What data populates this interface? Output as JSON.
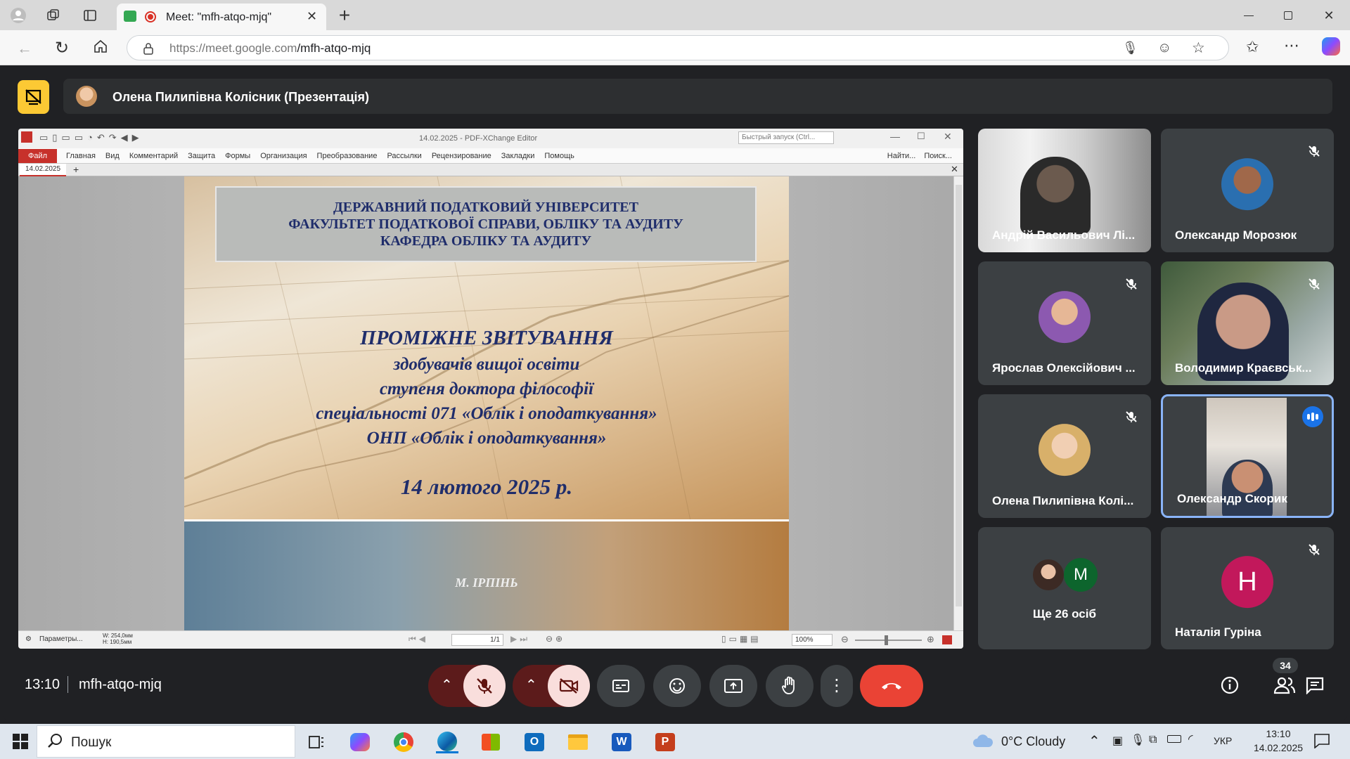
{
  "browser": {
    "tab_title": "Meet: \"mfh-atqo-mjq\"",
    "url_host": "https://meet.google.com",
    "url_path": "/mfh-atqo-mjq"
  },
  "presentation": {
    "presenter": "Олена Пилипівна Колісник (Презентація)"
  },
  "pdf_editor": {
    "window_title": "14.02.2025 - PDF-XChange Editor",
    "quick_launch": "Быстрый запуск (Ctrl...",
    "menu": [
      "Файл",
      "Главная",
      "Вид",
      "Комментарий",
      "Защита",
      "Формы",
      "Организация",
      "Преобразование",
      "Рассылки",
      "Рецензирование",
      "Закладки",
      "Помощь"
    ],
    "find": "Найти...",
    "search": "Поиск...",
    "doc_tab": "14.02.2025",
    "status_params": "Параметры...",
    "status_size_w": "W: 254,0мм",
    "status_size_h": "H: 190,5мм",
    "page_field": "1/1",
    "zoom": "100%"
  },
  "slide": {
    "header_lines": [
      "ДЕРЖАВНИЙ ПОДАТКОВИЙ УНІВЕРСИТЕТ",
      "ФАКУЛЬТЕТ ПОДАТКОВОЇ СПРАВИ, ОБЛІКУ ТА АУДИТУ",
      "КАФЕДРА ОБЛІКУ ТА АУДИТУ"
    ],
    "title": "ПРОМІЖНЕ ЗВІТУВАННЯ",
    "lines": [
      "здобувачів вищої освіти",
      "ступеня доктора філософії",
      "спеціальності 071 «Облік і оподаткування»",
      "ОНП «Облік і оподаткування»"
    ],
    "date": "14 лютого 2025 р.",
    "city": "М. ІРПІНЬ"
  },
  "participants": [
    {
      "name": "Андрій Васильович Лі...",
      "muted": false
    },
    {
      "name": "Олександр Морозюк",
      "muted": true
    },
    {
      "name": "Ярослав Олексійович ...",
      "muted": true
    },
    {
      "name": "Володимир Краєвськ...",
      "muted": true
    },
    {
      "name": "Олена Пилипівна Колі...",
      "muted": true
    },
    {
      "name": "Олександр Скорик",
      "muted": false,
      "speaking": true
    },
    {
      "name": "Ще 26 осіб",
      "avatar_letter": "M"
    },
    {
      "name": "Наталія Гуріна",
      "avatar_letter": "Н",
      "muted": true
    }
  ],
  "meeting": {
    "time": "13:10",
    "code": "mfh-atqo-mjq",
    "people_count": "34"
  },
  "taskbar": {
    "search_placeholder": "Пошук",
    "weather": "0°C  Cloudy",
    "lang": "УКР",
    "clock_time": "13:10",
    "clock_date": "14.02.2025"
  },
  "colors": {
    "accent": "#8ab4f8",
    "end_call": "#ea4335",
    "mute_bg": "#f9dedc",
    "presenting": "#fcc934"
  }
}
